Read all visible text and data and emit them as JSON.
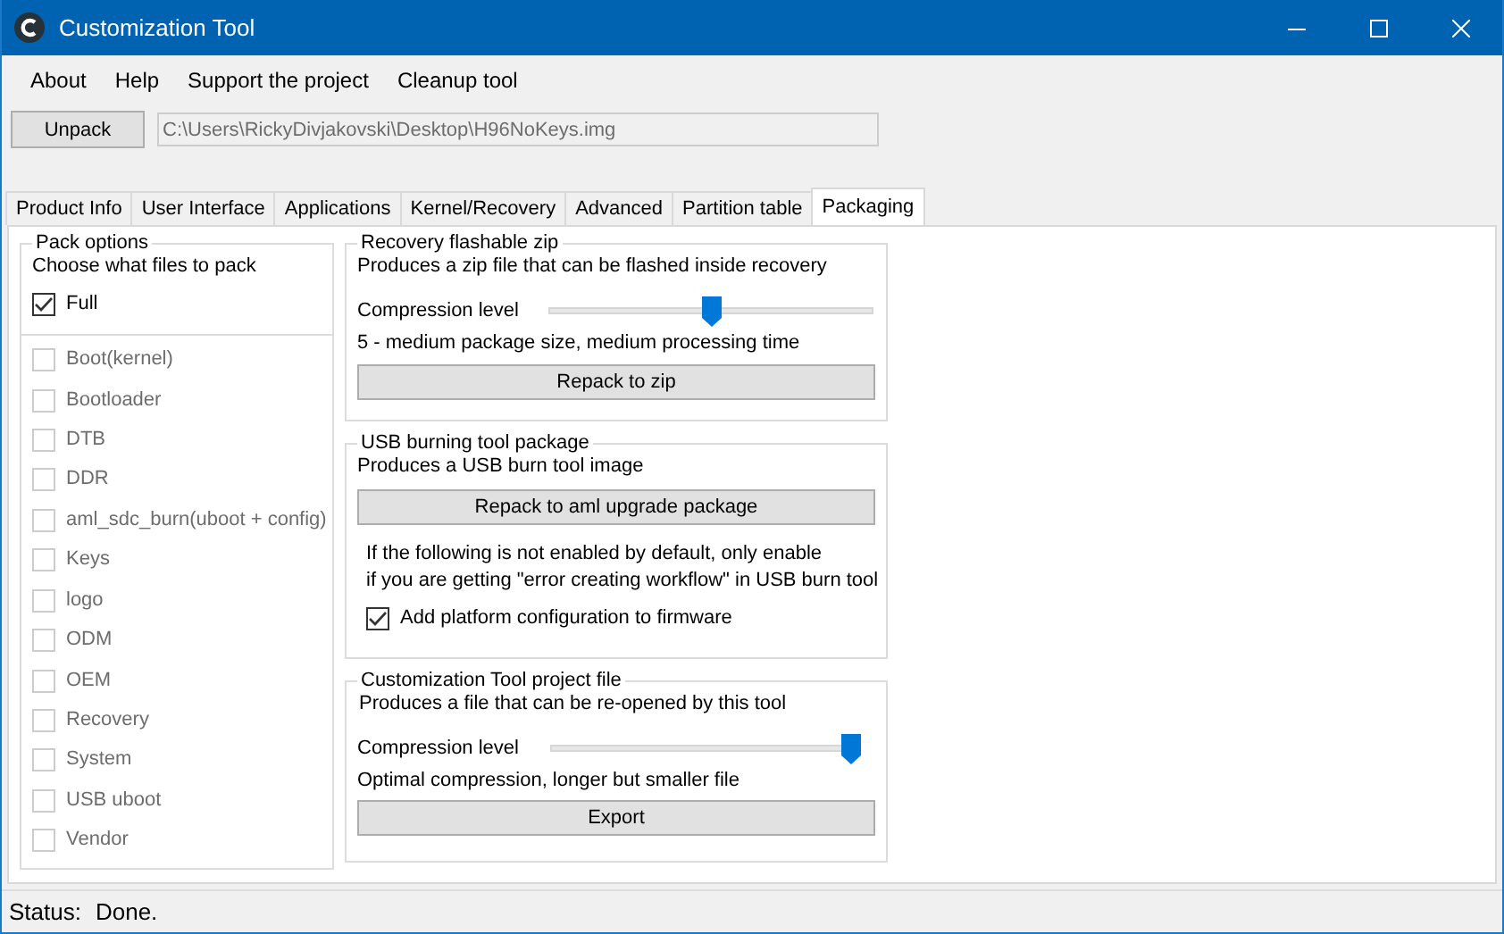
{
  "window": {
    "title": "Customization Tool"
  },
  "menu": [
    "About",
    "Help",
    "Support the project",
    "Cleanup tool"
  ],
  "unpack": {
    "button": "Unpack",
    "path": "C:\\Users\\RickyDivjakovski\\Desktop\\H96NoKeys.img"
  },
  "tabs": [
    {
      "label": "Product Info",
      "selected": false
    },
    {
      "label": "User Interface",
      "selected": false
    },
    {
      "label": "Applications",
      "selected": false
    },
    {
      "label": "Kernel/Recovery",
      "selected": false
    },
    {
      "label": "Advanced",
      "selected": false
    },
    {
      "label": "Partition table",
      "selected": false
    },
    {
      "label": "Packaging",
      "selected": true
    }
  ],
  "pack_options": {
    "title": "Pack options",
    "subtitle": "Choose what files to pack",
    "full": {
      "label": "Full",
      "checked": true
    },
    "items": [
      {
        "label": "Boot(kernel)",
        "checked": false,
        "disabled": true
      },
      {
        "label": "Bootloader",
        "checked": false,
        "disabled": true
      },
      {
        "label": "DTB",
        "checked": false,
        "disabled": true
      },
      {
        "label": "DDR",
        "checked": false,
        "disabled": true
      },
      {
        "label": "aml_sdc_burn(uboot + config)",
        "checked": false,
        "disabled": true
      },
      {
        "label": "Keys",
        "checked": false,
        "disabled": true
      },
      {
        "label": "logo",
        "checked": false,
        "disabled": true
      },
      {
        "label": "ODM",
        "checked": false,
        "disabled": true
      },
      {
        "label": "OEM",
        "checked": false,
        "disabled": true
      },
      {
        "label": "Recovery",
        "checked": false,
        "disabled": true
      },
      {
        "label": "System",
        "checked": false,
        "disabled": true
      },
      {
        "label": "USB uboot",
        "checked": false,
        "disabled": true
      },
      {
        "label": "Vendor",
        "checked": false,
        "disabled": true
      }
    ]
  },
  "recovery_zip": {
    "title": "Recovery flashable zip",
    "description": "Produces a zip file that can be flashed inside recovery",
    "slider_label": "Compression level",
    "level": 0.5,
    "reading": "5 - medium package size, medium processing time",
    "button": "Repack to zip"
  },
  "usb_package": {
    "title": "USB burning tool package",
    "description": "Produces a USB burn tool image",
    "button": "Repack to aml upgrade package",
    "note": [
      "If the following is not enabled by default, only enable",
      "if you are getting \"error creating workflow\" in USB burn tool"
    ],
    "checkbox": {
      "label": "Add platform configuration to firmware",
      "checked": true
    }
  },
  "project_file": {
    "title": "Customization Tool project file",
    "description": "Produces a file that can be re-opened by this tool",
    "slider_label": "Compression level",
    "level": 1,
    "reading": "Optimal compression, longer but smaller file",
    "button": "Export"
  },
  "status_bar": {
    "label": "Status:",
    "value": "Done."
  }
}
